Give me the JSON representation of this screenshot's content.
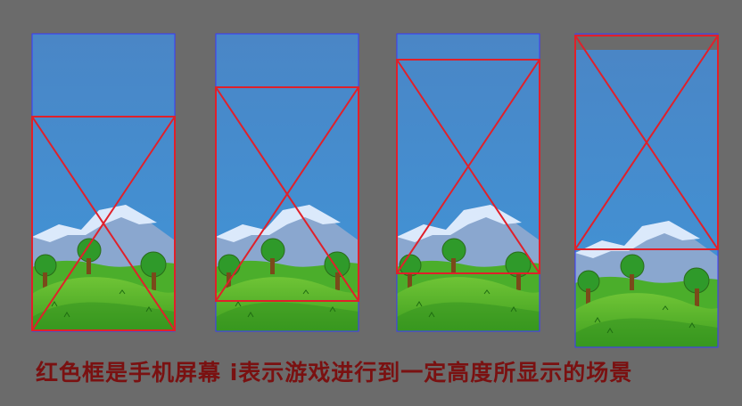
{
  "caption": "红色框是手机屏幕 i表示游戏进行到一定高度所显示的场景",
  "colors": {
    "background": "#6b6b6b",
    "screen_frame": "#e0202a",
    "panel_border": "#3a3aff",
    "sky_top": "#4a86c6",
    "sky_bottom": "#3f95d8",
    "mountain": "#dbe9fb",
    "mountain_shadow": "#8aa7cf",
    "hills": "#5cbf2a",
    "trees": "#2f9a2a",
    "caption": "#7a1111"
  },
  "panels": [
    {
      "name": "scene-panel-1",
      "screen_frame_covers": "lower part"
    },
    {
      "name": "scene-panel-2",
      "screen_frame_covers": "middle part"
    },
    {
      "name": "scene-panel-3",
      "screen_frame_covers": "upper-middle part"
    },
    {
      "name": "scene-panel-4",
      "screen_frame_covers": "top part, extended above"
    }
  ]
}
